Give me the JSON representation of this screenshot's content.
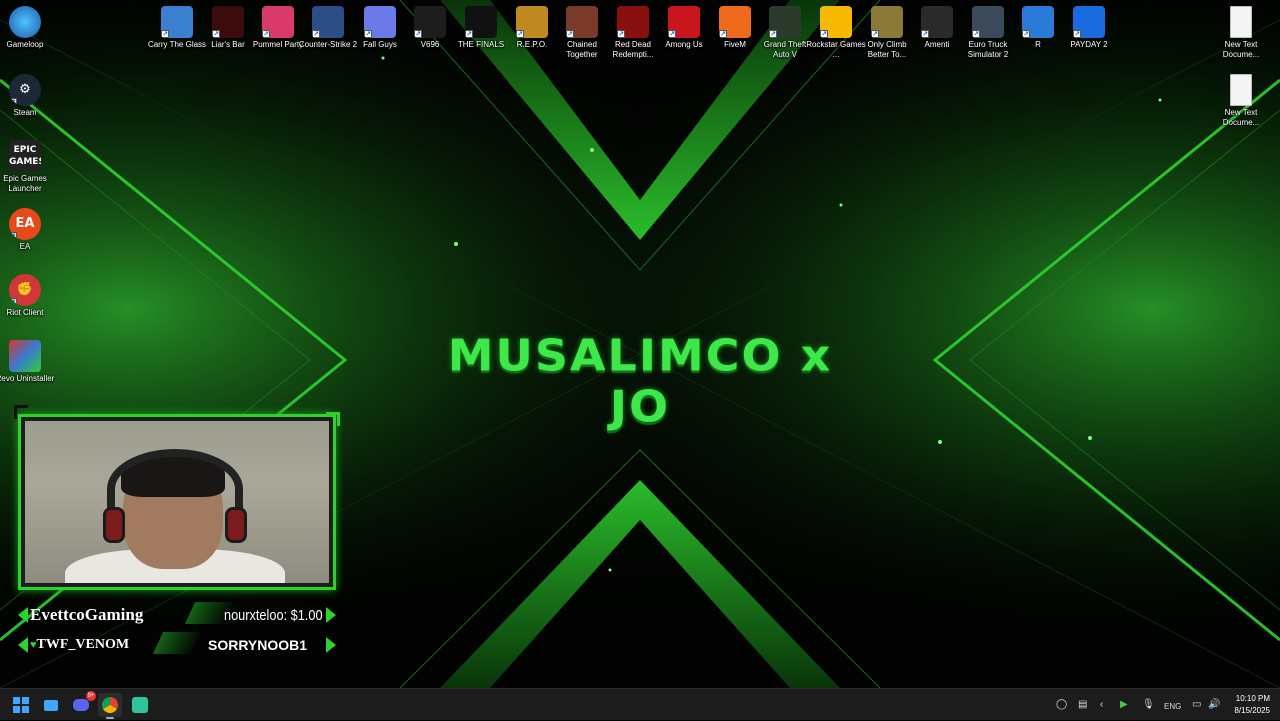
{
  "wallpaper": {
    "title": "MUSALIMCO x JO",
    "accent_color": "#3fe84a"
  },
  "desktop_icons_top": [
    {
      "label": "Carry The Glass",
      "icon": "carry-the-glass-icon",
      "color": "#3a7fd0"
    },
    {
      "label": "Liar's Bar",
      "icon": "liars-bar-icon",
      "color": "#3a0c0c"
    },
    {
      "label": "Pummel Party",
      "icon": "pummel-party-icon",
      "color": "#d83a6a"
    },
    {
      "label": "Counter-Strike 2",
      "icon": "counter-strike-icon",
      "color": "#2b4e86"
    },
    {
      "label": "Fall Guys",
      "icon": "fall-guys-icon",
      "color": "#6a7ae6"
    },
    {
      "label": "V696",
      "icon": "v696-icon",
      "color": "#1d1d1d"
    },
    {
      "label": "THE FINALS",
      "icon": "the-finals-icon",
      "color": "#111111"
    },
    {
      "label": "R.E.P.O.",
      "icon": "repo-icon",
      "color": "#c08a20"
    },
    {
      "label": "Chained Together",
      "icon": "chained-together-icon",
      "color": "#7a3a2a"
    },
    {
      "label": "Red Dead Redempti...",
      "icon": "red-dead-icon",
      "color": "#8a1010"
    },
    {
      "label": "Among Us",
      "icon": "among-us-icon",
      "color": "#c8161c"
    },
    {
      "label": "FiveM",
      "icon": "fivem-icon",
      "color": "#f06a1e"
    },
    {
      "label": "Grand Theft Auto V",
      "icon": "gta-v-icon",
      "color": "#2c3a2c"
    },
    {
      "label": "Rockstar Games ...",
      "icon": "rockstar-icon",
      "color": "#f6b800"
    },
    {
      "label": "Only Climb Better To...",
      "icon": "only-climb-icon",
      "color": "#8a7a3a"
    },
    {
      "label": "Amenti",
      "icon": "amenti-icon",
      "color": "#2a2a2a"
    },
    {
      "label": "Euro Truck Simulator 2",
      "icon": "euro-truck-icon",
      "color": "#3a4a5a"
    },
    {
      "label": "R",
      "icon": "rocket-league-icon",
      "color": "#2a7ad8"
    },
    {
      "label": "PAYDAY 2",
      "icon": "payday-icon",
      "color": "#1a6ae0"
    }
  ],
  "desktop_icons_right": [
    {
      "label": "New Text Docume...",
      "icon": "text-document-icon"
    },
    {
      "label": "New Text Docume...",
      "icon": "text-document-icon"
    }
  ],
  "desktop_icons_left": [
    {
      "label": "Gameloop",
      "icon": "gameloop-icon",
      "color": "#1b7ac8"
    },
    {
      "label": "Steam",
      "icon": "steam-icon",
      "color": "#1b2838"
    },
    {
      "label": "Epic Games Launcher",
      "icon": "epic-games-icon",
      "color": "#222222"
    },
    {
      "label": "EA",
      "icon": "ea-icon",
      "color": "#e8491b"
    },
    {
      "label": "Riot Client",
      "icon": "riot-client-icon",
      "color": "#d13639"
    },
    {
      "label": "Revo Uninstaller",
      "icon": "revo-uninstaller-icon",
      "color": "#3a7ad0"
    }
  ],
  "stream_overlay": {
    "channel_name": "EvettcoGaming",
    "donation": "nourxteloo: $1.00",
    "follower": "TWF_VENOM",
    "subscriber": "SORRYNOOB1"
  },
  "taskbar": {
    "apps": [
      "start-icon",
      "file-explorer-icon",
      "discord-icon",
      "chrome-icon",
      "app-icon"
    ],
    "discord_badge": "9+",
    "language": "ENG",
    "time": "10:10 PM",
    "date": "8/15/2025"
  }
}
